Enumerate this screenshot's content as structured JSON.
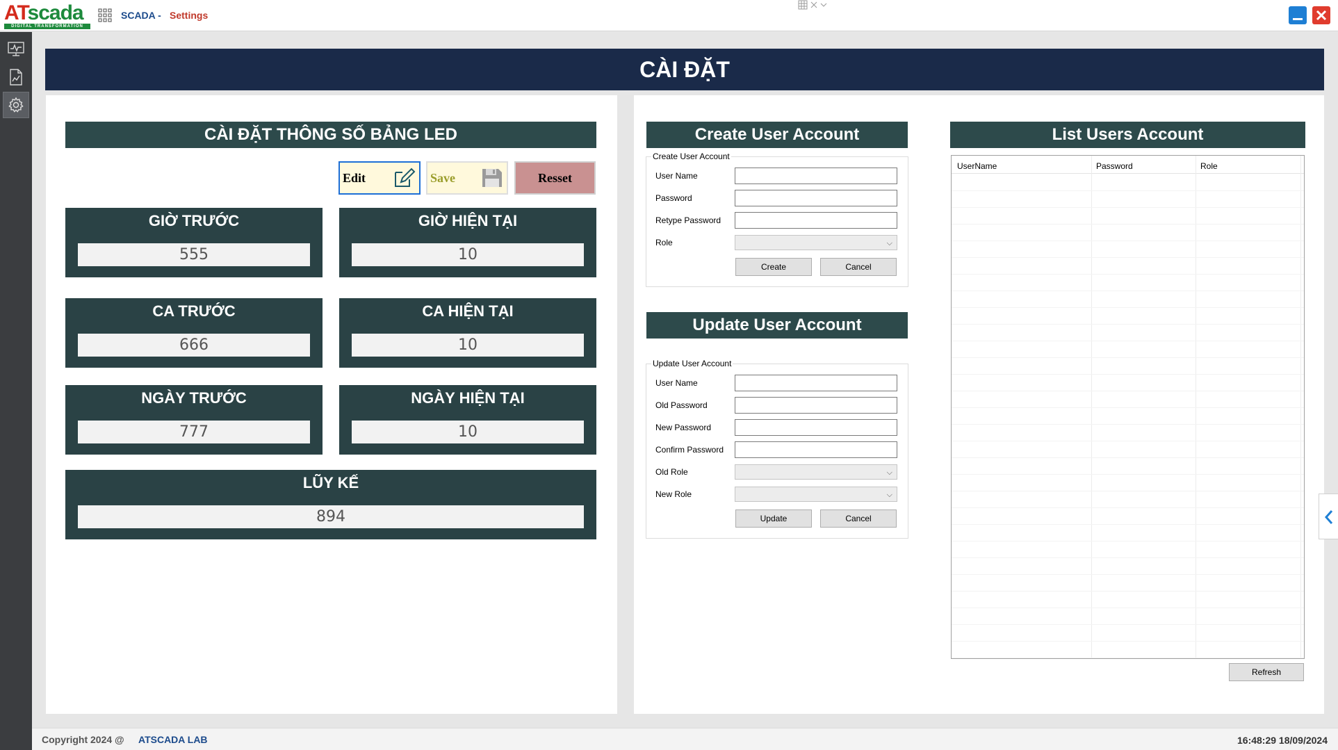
{
  "window": {
    "logo_main_a": "AT",
    "logo_main_b": "scada",
    "logo_sub": "DIGITAL TRANSFORMATION",
    "app_title": "SCADA -",
    "page_title": "Settings"
  },
  "sidebar": {
    "items": [
      {
        "icon": "monitor-icon"
      },
      {
        "icon": "report-icon"
      },
      {
        "icon": "gear-icon",
        "active": true
      }
    ]
  },
  "header": {
    "title": "CÀI ĐẶT"
  },
  "led": {
    "title": "CÀI ĐẶT THÔNG SỐ BẢNG LED",
    "edit_label": "Edit",
    "save_label": "Save",
    "reset_label": "Resset",
    "cards": [
      {
        "label": "GIỜ TRƯỚC",
        "value": "555"
      },
      {
        "label": "GIỜ HIỆN TẠI",
        "value": "10"
      },
      {
        "label": "CA TRƯỚC",
        "value": "666"
      },
      {
        "label": "CA HIỆN TẠI",
        "value": "10"
      },
      {
        "label": "NGÀY TRƯỚC",
        "value": "777"
      },
      {
        "label": "NGÀY HIỆN TẠI",
        "value": "10"
      },
      {
        "label": "LŨY KẾ",
        "value": "894"
      }
    ]
  },
  "create_user": {
    "title": "Create User Account",
    "group_label": "Create User Account",
    "fields": [
      "User Name",
      "Password",
      "Retype Password",
      "Role"
    ],
    "create_label": "Create",
    "cancel_label": "Cancel"
  },
  "update_user": {
    "title": "Update User Account",
    "group_label": "Update User Account",
    "fields": [
      "User Name",
      "Old Password",
      "New Password",
      "Confirm Password",
      "Old Role",
      "New Role"
    ],
    "update_label": "Update",
    "cancel_label": "Cancel"
  },
  "users_list": {
    "title": "List Users Account",
    "columns": [
      "UserName",
      "Password",
      "Role"
    ],
    "rows": [],
    "refresh_label": "Refresh"
  },
  "footer": {
    "copyright": "Copyright 2024 @",
    "lab": "ATSCADA LAB",
    "clock": "16:48:29 18/09/2024"
  },
  "colors": {
    "banner": "#1a2a49",
    "section_header": "#2d4a4b",
    "card": "#2a4245",
    "reset_button": "#c99191",
    "edit_border": "#1d6fd6",
    "brand_red": "#d42a1c",
    "brand_green": "#1d8a3c"
  }
}
